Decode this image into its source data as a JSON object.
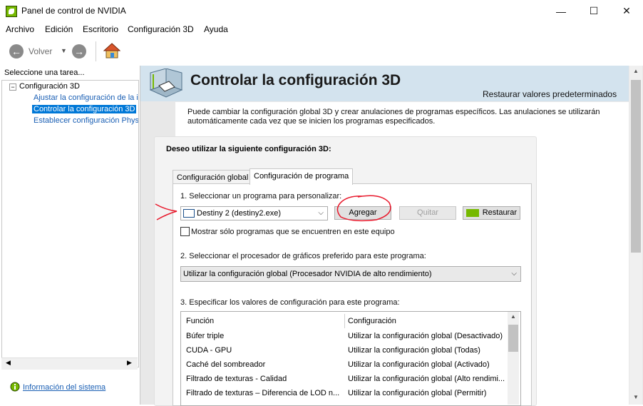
{
  "window": {
    "title": "Panel de control de NVIDIA",
    "minimize": "—",
    "maximize": "☐",
    "close": "✕"
  },
  "menu": [
    "Archivo",
    "Edición",
    "Escritorio",
    "Configuración 3D",
    "Ayuda"
  ],
  "toolbar": {
    "back_label": "Volver",
    "back_arrow": "←",
    "forward_arrow": "→",
    "dropdown_arrow": "▼",
    "home_icon": "home-icon"
  },
  "sidebar": {
    "task_label": "Seleccione una tarea...",
    "root": "Configuración 3D",
    "items": [
      {
        "label": "Ajustar la configuración de la i",
        "selected": false
      },
      {
        "label": "Controlar la configuración 3D",
        "selected": true
      },
      {
        "label": "Establecer configuración Phys",
        "selected": false
      }
    ],
    "system_info": "Información del sistema"
  },
  "main": {
    "title": "Controlar la configuración 3D",
    "restore_defaults": "Restaurar valores predeterminados",
    "description": "Puede cambiar la configuración global 3D y crear anulaciones de programas específicos. Las anulaciones se utilizarán automáticamente cada vez que se inicien los programas especificados.",
    "group_title": "Deseo utilizar la siguiente configuración 3D:",
    "tabs": [
      {
        "label": "Configuración global",
        "active": false
      },
      {
        "label": "Configuración de programa",
        "active": true
      }
    ],
    "step1": "1. Seleccionar un programa para personalizar:",
    "program_value": "Destiny 2 (destiny2.exe)",
    "add_button": "Agregar",
    "remove_button": "Quitar",
    "restore_button": "Restaurar",
    "show_only_checkbox": "Mostrar sólo programas que se encuentren en este equipo",
    "step2": "2. Seleccionar el procesador de gráficos preferido para este programa:",
    "gpu_value": "Utilizar la configuración global (Procesador NVIDIA de alto rendimiento)",
    "step3": "3. Especificar los valores de configuración para este programa:",
    "grid_headers": {
      "function": "Función",
      "setting": "Configuración"
    },
    "grid_rows": [
      {
        "function": "Búfer triple",
        "setting": "Utilizar la configuración global (Desactivado)"
      },
      {
        "function": "CUDA - GPU",
        "setting": "Utilizar la configuración global (Todas)"
      },
      {
        "function": "Caché del sombreador",
        "setting": "Utilizar la configuración global (Activado)"
      },
      {
        "function": "Filtrado de texturas - Calidad",
        "setting": "Utilizar la configuración global (Alto rendimi..."
      },
      {
        "function": "Filtrado de texturas – Diferencia de LOD n...",
        "setting": "Utilizar la configuración global (Permitir)"
      }
    ]
  },
  "colors": {
    "accent": "#0078d7",
    "nvidia_green": "#76b900",
    "annotation_red": "#e8192c",
    "header_bg": "#d3e3ee"
  }
}
